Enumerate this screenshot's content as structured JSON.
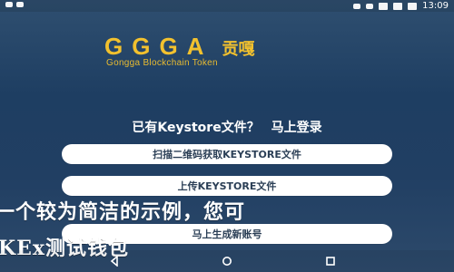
{
  "status_bar": {
    "time": "13:09",
    "icons": [
      "notification-icon",
      "bluetooth-icon",
      "alarm-icon",
      "wifi-icon",
      "signal-icon",
      "battery-icon"
    ]
  },
  "logo": {
    "mark": "GGGA",
    "cn": "贡嘎",
    "subtitle": "Gongga Blockchain Token",
    "color": "#f2c12e"
  },
  "prompt": {
    "question": "已有Keystore文件？",
    "link": "马上登录"
  },
  "buttons": {
    "scan": "扫描二维码获取KEYSTORE文件",
    "upload": "上传KEYSTORE文件",
    "register": "马上生成新账号"
  },
  "overlay": {
    "line1": "一个较为简洁的示例，您可",
    "line2": "KEx测试钱包"
  },
  "nav": {
    "back": "back-icon",
    "home": "home-icon",
    "recent": "recent-apps-icon"
  }
}
